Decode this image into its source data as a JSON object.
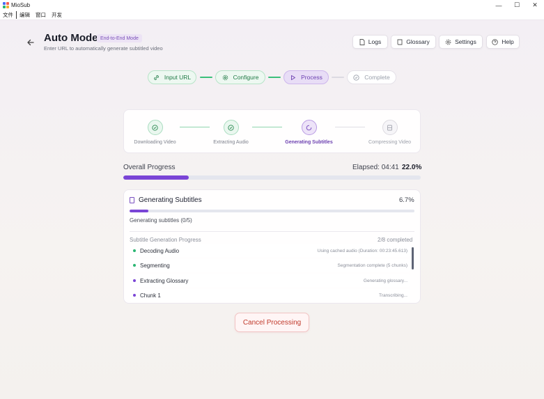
{
  "window": {
    "title": "MioSub",
    "minimize": "—",
    "maximize": "☐",
    "close": "✕"
  },
  "menu": [
    "文件",
    "编辑",
    "窗口",
    "开发"
  ],
  "header": {
    "title": "Auto Mode",
    "badge": "End-to-End Mode",
    "subtitle": "Enter URL to automatically generate subtitled video",
    "buttons": {
      "logs": "Logs",
      "glossary": "Glossary",
      "settings": "Settings",
      "help": "Help"
    }
  },
  "steps": [
    {
      "label": "Input URL",
      "state": "done",
      "icon": "link-icon"
    },
    {
      "label": "Configure",
      "state": "done",
      "icon": "gear-icon"
    },
    {
      "label": "Process",
      "state": "active",
      "icon": "play-icon"
    },
    {
      "label": "Complete",
      "state": "pending",
      "icon": "check-circle-icon"
    }
  ],
  "substeps": [
    {
      "label": "Downloading Video",
      "state": "done",
      "icon": "check-circle-icon"
    },
    {
      "label": "Extracting Audio",
      "state": "done",
      "icon": "check-circle-icon"
    },
    {
      "label": "Generating Subtitles",
      "state": "active",
      "icon": "spinner-icon"
    },
    {
      "label": "Compressing Video",
      "state": "pending",
      "icon": "film-icon"
    }
  ],
  "overall": {
    "label": "Overall Progress",
    "elapsed": "Elapsed: 04:41",
    "percent_text": "22.0%",
    "progress": 0.22
  },
  "task": {
    "title": "Generating Subtitles",
    "percent_text": "6.7%",
    "progress": 0.067,
    "status": "Generating subtitles (0/5)",
    "section_label": "Subtitle Generation Progress",
    "section_count": "2/8 completed",
    "items": [
      {
        "name": "Decoding Audio",
        "detail": "Using cached audio (Duration: 00:23:45.613)",
        "status_color": "#2bb673"
      },
      {
        "name": "Segmenting",
        "detail": "Segmentation complete (5 chunks)",
        "status_color": "#2bb673"
      },
      {
        "name": "Extracting Glossary",
        "detail": "Generating glossary...",
        "status_color": "#7a45d6"
      },
      {
        "name": "Chunk 1",
        "detail": "Transcribing...",
        "status_color": "#7a45d6"
      }
    ]
  },
  "cancel_label": "Cancel Processing",
  "colors": {
    "accent": "#7a45d6",
    "success": "#2bb673",
    "danger": "#c0392b"
  }
}
